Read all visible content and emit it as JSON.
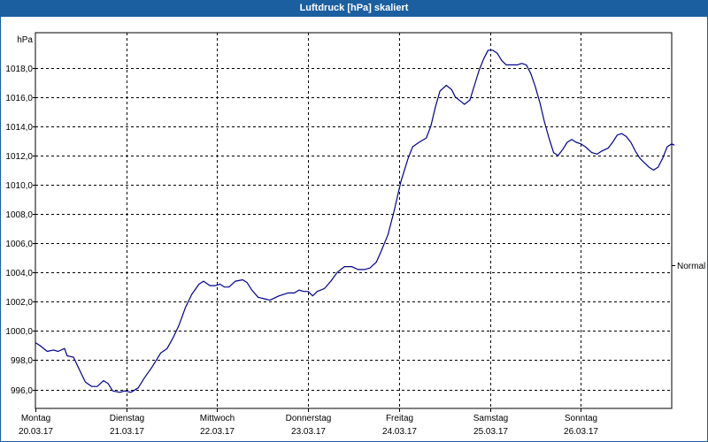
{
  "window": {
    "title": "Luftdruck [hPa] skaliert"
  },
  "colors": {
    "title_bar": "#1c5fa0",
    "line": "#00008b",
    "grid": "#000000"
  },
  "chart_data": {
    "type": "line",
    "title": "Luftdruck [hPa] skaliert",
    "ylabel": "hPa",
    "ylim": [
      994.7,
      1020.4
    ],
    "y_ticks": [
      996.0,
      998.0,
      1000.0,
      1002.0,
      1004.0,
      1006.0,
      1008.0,
      1010.0,
      1012.0,
      1014.0,
      1016.0,
      1018.0
    ],
    "y_tick_labels": [
      "996,0",
      "998,0",
      "1000,0",
      "1002,0",
      "1004,0",
      "1006,0",
      "1008,0",
      "1010,0",
      "1012,0",
      "1014,0",
      "1016,0",
      "1018,0"
    ],
    "xlim": [
      0,
      7.0
    ],
    "x_ticks": [
      {
        "x": 0,
        "day": "Montag",
        "date": "20.03.17"
      },
      {
        "x": 1,
        "day": "Dienstag",
        "date": "21.03.17"
      },
      {
        "x": 2,
        "day": "Mittwoch",
        "date": "22.03.17"
      },
      {
        "x": 3,
        "day": "Donnerstag",
        "date": "23.03.17"
      },
      {
        "x": 4,
        "day": "Freitag",
        "date": "24.03.17"
      },
      {
        "x": 5,
        "day": "Samstag",
        "date": "25.03.17"
      },
      {
        "x": 6,
        "day": "Sonntag",
        "date": "26.03.17"
      }
    ],
    "reference_line": {
      "label": "Normal",
      "y": 1004.5
    },
    "grid": true,
    "series": [
      {
        "points": [
          [
            0.0,
            999.2
          ],
          [
            0.05,
            999.0
          ],
          [
            0.13,
            998.6
          ],
          [
            0.2,
            998.7
          ],
          [
            0.25,
            998.6
          ],
          [
            0.32,
            998.8
          ],
          [
            0.35,
            998.3
          ],
          [
            0.42,
            998.2
          ],
          [
            0.48,
            997.4
          ],
          [
            0.55,
            996.5
          ],
          [
            0.62,
            996.2
          ],
          [
            0.68,
            996.2
          ],
          [
            0.75,
            996.6
          ],
          [
            0.8,
            996.4
          ],
          [
            0.85,
            995.9
          ],
          [
            0.93,
            995.8
          ],
          [
            0.98,
            995.9
          ],
          [
            1.05,
            995.8
          ],
          [
            1.13,
            996.1
          ],
          [
            1.2,
            996.8
          ],
          [
            1.28,
            997.5
          ],
          [
            1.33,
            998.0
          ],
          [
            1.38,
            998.5
          ],
          [
            1.45,
            998.8
          ],
          [
            1.52,
            999.6
          ],
          [
            1.58,
            1000.4
          ],
          [
            1.65,
            1001.6
          ],
          [
            1.72,
            1002.5
          ],
          [
            1.8,
            1003.2
          ],
          [
            1.85,
            1003.4
          ],
          [
            1.92,
            1003.1
          ],
          [
            1.98,
            1003.1
          ],
          [
            2.03,
            1003.2
          ],
          [
            2.08,
            1003.0
          ],
          [
            2.13,
            1003.0
          ],
          [
            2.2,
            1003.4
          ],
          [
            2.28,
            1003.5
          ],
          [
            2.33,
            1003.3
          ],
          [
            2.38,
            1002.8
          ],
          [
            2.45,
            1002.3
          ],
          [
            2.52,
            1002.2
          ],
          [
            2.58,
            1002.1
          ],
          [
            2.68,
            1002.4
          ],
          [
            2.78,
            1002.6
          ],
          [
            2.85,
            1002.6
          ],
          [
            2.9,
            1002.8
          ],
          [
            2.95,
            1002.7
          ],
          [
            3.0,
            1002.7
          ],
          [
            3.05,
            1002.4
          ],
          [
            3.1,
            1002.7
          ],
          [
            3.18,
            1002.9
          ],
          [
            3.25,
            1003.4
          ],
          [
            3.32,
            1004.0
          ],
          [
            3.4,
            1004.4
          ],
          [
            3.48,
            1004.4
          ],
          [
            3.55,
            1004.2
          ],
          [
            3.62,
            1004.2
          ],
          [
            3.68,
            1004.3
          ],
          [
            3.75,
            1004.7
          ],
          [
            3.8,
            1005.4
          ],
          [
            3.88,
            1006.6
          ],
          [
            3.95,
            1008.3
          ],
          [
            4.02,
            1010.2
          ],
          [
            4.1,
            1011.8
          ],
          [
            4.15,
            1012.6
          ],
          [
            4.22,
            1012.9
          ],
          [
            4.3,
            1013.2
          ],
          [
            4.35,
            1014.0
          ],
          [
            4.4,
            1015.3
          ],
          [
            4.45,
            1016.4
          ],
          [
            4.52,
            1016.8
          ],
          [
            4.58,
            1016.5
          ],
          [
            4.62,
            1016.0
          ],
          [
            4.68,
            1015.7
          ],
          [
            4.72,
            1015.5
          ],
          [
            4.78,
            1015.8
          ],
          [
            4.83,
            1016.8
          ],
          [
            4.88,
            1017.8
          ],
          [
            4.93,
            1018.6
          ],
          [
            4.98,
            1019.2
          ],
          [
            5.03,
            1019.2
          ],
          [
            5.08,
            1019.0
          ],
          [
            5.13,
            1018.5
          ],
          [
            5.18,
            1018.2
          ],
          [
            5.25,
            1018.2
          ],
          [
            5.3,
            1018.2
          ],
          [
            5.35,
            1018.3
          ],
          [
            5.4,
            1018.2
          ],
          [
            5.45,
            1017.6
          ],
          [
            5.5,
            1016.7
          ],
          [
            5.55,
            1015.6
          ],
          [
            5.6,
            1014.3
          ],
          [
            5.65,
            1013.2
          ],
          [
            5.7,
            1012.2
          ],
          [
            5.75,
            1012.0
          ],
          [
            5.8,
            1012.4
          ],
          [
            5.85,
            1012.9
          ],
          [
            5.9,
            1013.1
          ],
          [
            5.95,
            1012.9
          ],
          [
            6.0,
            1012.8
          ],
          [
            6.05,
            1012.6
          ],
          [
            6.12,
            1012.2
          ],
          [
            6.18,
            1012.1
          ],
          [
            6.23,
            1012.3
          ],
          [
            6.3,
            1012.5
          ],
          [
            6.35,
            1012.9
          ],
          [
            6.4,
            1013.4
          ],
          [
            6.45,
            1013.5
          ],
          [
            6.5,
            1013.3
          ],
          [
            6.55,
            1012.9
          ],
          [
            6.6,
            1012.3
          ],
          [
            6.65,
            1011.8
          ],
          [
            6.7,
            1011.5
          ],
          [
            6.75,
            1011.2
          ],
          [
            6.8,
            1011.0
          ],
          [
            6.85,
            1011.2
          ],
          [
            6.9,
            1011.8
          ],
          [
            6.95,
            1012.6
          ],
          [
            7.0,
            1012.8
          ],
          [
            7.03,
            1012.7
          ]
        ]
      }
    ]
  }
}
